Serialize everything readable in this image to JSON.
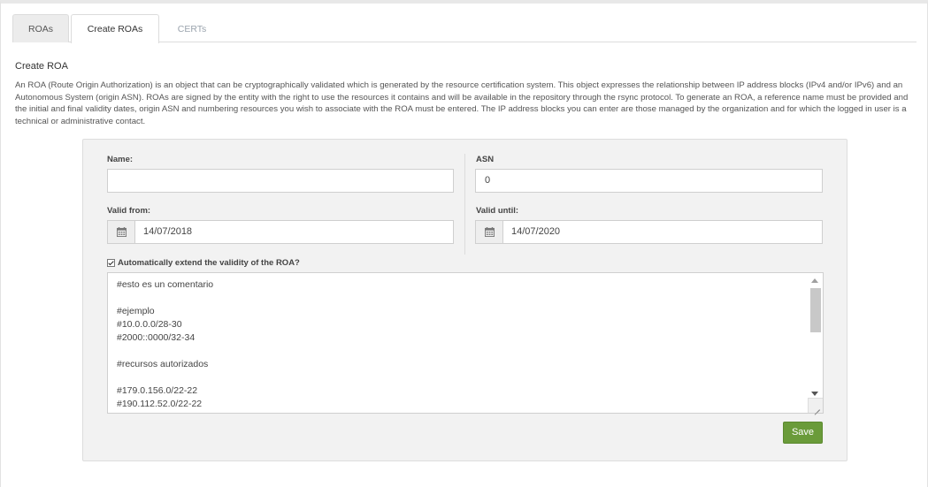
{
  "tabs": [
    {
      "label": "ROAs"
    },
    {
      "label": "Create ROAs"
    },
    {
      "label": "CERTs"
    }
  ],
  "heading": "Create ROA",
  "description": "An ROA (Route Origin Authorization) is an object that can be cryptographically validated which is generated by the resource certification system. This object expresses the relationship between IP address blocks (IPv4 and/or IPv6) and an Autonomous System (origin ASN). ROAs are signed by the entity with the right to use the resources it contains and will be available in the repository through the rsync protocol. To generate an ROA, a reference name must be provided and the initial and final validity dates, origin ASN and numbering resources you wish to associate with the ROA must be entered. The IP address blocks you can enter are those managed by the organization and for which the logged in user is a technical or administrative contact.",
  "form": {
    "name_label": "Name:",
    "name_value": "",
    "asn_label": "ASN",
    "asn_value": "0",
    "valid_from_label": "Valid from:",
    "valid_from_value": "14/07/2018",
    "valid_until_label": "Valid until:",
    "valid_until_value": "14/07/2020",
    "extend_label": "Automatically extend the validity of the ROA?",
    "extend_checked": true,
    "resources_lines": [
      "#esto es un comentario",
      "",
      "#ejemplo",
      "#10.0.0.0/28-30",
      "#2000::0000/32-34",
      "",
      "#recursos autorizados",
      "",
      "#179.0.156.0/22-22",
      "#190.112.52.0/22-22"
    ],
    "save_label": "Save"
  },
  "icons": {
    "calendar": "calendar-icon"
  },
  "colors": {
    "save_button": "#6a9b3a",
    "panel_background": "#f2f2f2",
    "inactive_tab_text": "#9aa3ad"
  }
}
